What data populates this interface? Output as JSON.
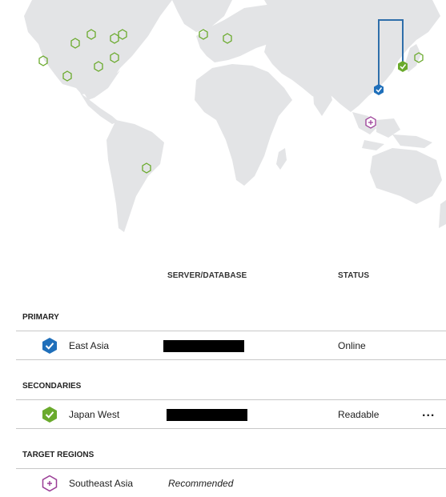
{
  "columns": {
    "server_database": "SERVER/DATABASE",
    "status": "STATUS"
  },
  "sections": {
    "primary": "PRIMARY",
    "secondaries": "SECONDARIES",
    "target_regions": "TARGET REGIONS"
  },
  "primary": {
    "region": "East Asia",
    "status": "Online",
    "icon": "primary-check-icon",
    "color": "#1f6fba"
  },
  "secondary": {
    "region": "Japan West",
    "status": "Readable",
    "more": "...",
    "icon": "secondary-check-icon",
    "color": "#6aaa2c"
  },
  "target": {
    "region": "Southeast Asia",
    "note": "Recommended",
    "icon": "target-region-icon",
    "color": "#9a3c96"
  },
  "map": {
    "land_color": "#e6e7e8",
    "datacenter_color": "#6aaa2c",
    "link_color": "#2f6eaa"
  }
}
